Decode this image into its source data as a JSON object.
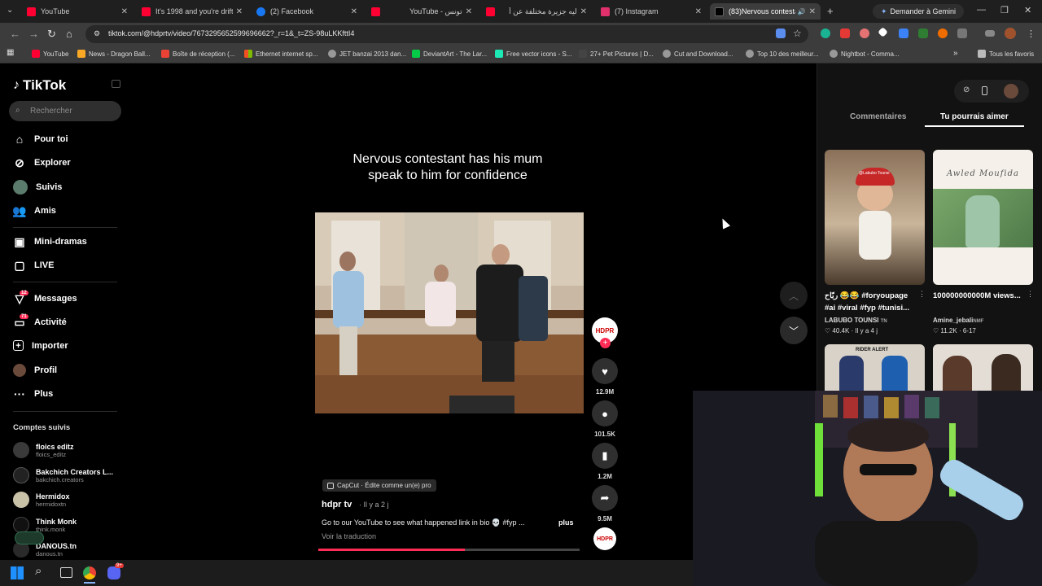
{
  "browser": {
    "tabs": [
      {
        "title": "YouTube",
        "color": "#ff0033"
      },
      {
        "title": "It's 1998 and you're driftin",
        "color": "#ff0033"
      },
      {
        "title": "(2) Facebook",
        "color": "#1877f2"
      },
      {
        "title": "YouTube - تونس",
        "color": "#ff0033"
      },
      {
        "title": "ليه جزيرة مختلفة عن أ",
        "color": "#ff0033"
      },
      {
        "title": "(7) Instagram",
        "color": "#e1306c"
      },
      {
        "title": "(83)Nervous contestan",
        "color": "#000000"
      }
    ],
    "gemini_label": "Demander à Gemini",
    "url": "tiktok.com/@hdprtv/video/7673295652599696662?_r=1&_t=ZS-98uLKKfttI4",
    "bookmarks": [
      "YouTube",
      "News - Dragon Ball...",
      "Boîte de réception (...",
      "Ethernet internet sp...",
      "JET banzai 2013 dan...",
      "DeviantArt - The Lar...",
      "Free vector icons - S...",
      "27+ Pet Pictures | D...",
      "Cut and Download...",
      "Top 10 des meilleur...",
      "Nightbot - Comma..."
    ],
    "all_bookmarks": "Tous les favoris"
  },
  "sidebar": {
    "logo": "TikTok",
    "search_placeholder": "Rechercher",
    "nav": [
      "Pour toi",
      "Explorer",
      "Suivis",
      "Amis",
      "Mini-dramas",
      "LIVE",
      "Messages",
      "Activité",
      "Importer",
      "Profil",
      "Plus"
    ],
    "messages_badge": "12",
    "activity_badge": "71",
    "followed_title": "Comptes suivis",
    "accounts": [
      {
        "name": "floics editz",
        "handle": "floics_editz"
      },
      {
        "name": "Bakchich Creators L...",
        "handle": "bakchich.creators"
      },
      {
        "name": "Hermidox",
        "handle": "hermidoxtn"
      },
      {
        "name": "Think Monk",
        "handle": "think.monk"
      },
      {
        "name": "DANOUS.tn",
        "handle": "danous.tn"
      }
    ]
  },
  "video": {
    "caption": "Nervous contestant has his mum speak to him for confidence",
    "likes": "12.9M",
    "comments": "101.5K",
    "saves": "1.2M",
    "shares": "9.5M",
    "avatar_text": "HDPR",
    "capcut": "CapCut · Édite comme un(e) pro",
    "author": "hdpr tv",
    "posted": "· Il y a 2 j",
    "description": "Go to our YouTube to see what happened link in bio 💀 #fyp ...",
    "more": "plus",
    "translate": "Voir la traduction",
    "progress": 0.56
  },
  "panel": {
    "tab_comments": "Commentaires",
    "tab_suggested": "Tu pourrais aimer",
    "cards": [
      {
        "title": "ربّاح 😂😂 #foryoupage #ai #viral #fyp #tunisi...",
        "author": "LABUBO TOUNSI",
        "author_tag": "TN",
        "likes": "40.4K",
        "date": "Il y a 4 j",
        "overlay": "@Labubo Tounsi"
      },
      {
        "title": "100000000000M views...",
        "author": "Amine_jebali",
        "author_tag": "NMF",
        "likes": "11.2K",
        "date": "6-17",
        "overlay": "Awled Moufida"
      },
      {
        "title": "",
        "author": "",
        "author_tag": "",
        "likes": "",
        "date": "",
        "overlay": "RIDER ALERT"
      },
      {
        "title": "",
        "author": "",
        "author_tag": "",
        "likes": "",
        "date": "",
        "overlay": ""
      }
    ]
  },
  "taskbar": {
    "discord_badge": "9+"
  }
}
